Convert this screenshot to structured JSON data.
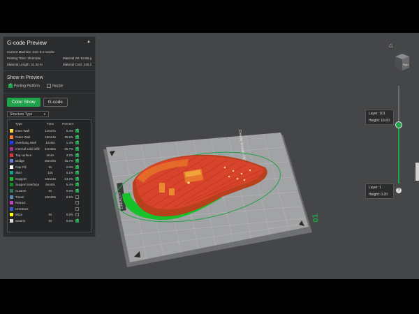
{
  "panel": {
    "title": "G-code Preview",
    "current_machine": "Current Machine: K1C 0.4 nozzle",
    "printing_time": "Printing Time: 2h4m16s",
    "material_wt": "Material Wt: 63.88 g",
    "material_length": "Material Length: 21.42 m",
    "material_cost": "Material Cost: 415.2",
    "show_in_preview": "Show in Preview",
    "printing_platform": "Printing Platform",
    "nozzle": "Nozzle",
    "tab_color_show": "Color Show",
    "tab_gcode": "G-code",
    "structure_select": "Structure Type",
    "legend_headers": {
      "type": "Type",
      "time": "Time",
      "percent": "Percent"
    },
    "legend": [
      {
        "color": "#ffd83a",
        "type": "Inner Wall",
        "time": "11m37s",
        "percent": "9.4%",
        "checked": true
      },
      {
        "color": "#ff7a2e",
        "type": "Outer Wall",
        "time": "19m24s",
        "percent": "15.6%",
        "checked": true
      },
      {
        "color": "#1e3cff",
        "type": "Overhang Wall",
        "time": "1m45s",
        "percent": "1.4%",
        "checked": true
      },
      {
        "color": "#b0309a",
        "type": "Internal solid infill",
        "time": "31m55s",
        "percent": "25.7%",
        "checked": true
      },
      {
        "color": "#e8333b",
        "type": "Top surface",
        "time": "4m2s",
        "percent": "3.2%",
        "checked": true
      },
      {
        "color": "#6b7dd6",
        "type": "Bridge",
        "time": "20m46s",
        "percent": "16.7%",
        "checked": true
      },
      {
        "color": "#ffffff",
        "type": "Gap Fill",
        "time": "0s",
        "percent": "0.0%",
        "checked": true
      },
      {
        "color": "#13a18f",
        "type": "Skirt",
        "time": "10s",
        "percent": "0.1%",
        "checked": true
      },
      {
        "color": "#16c22e",
        "type": "Support",
        "time": "16m21s",
        "percent": "13.2%",
        "checked": true
      },
      {
        "color": "#0f8e1e",
        "type": "Support interface",
        "time": "6m40s",
        "percent": "5.4%",
        "checked": true
      },
      {
        "color": "#2f7a55",
        "type": "Custom",
        "time": "0s",
        "percent": "0.0%",
        "checked": true
      },
      {
        "color": "#5a8ab8",
        "type": "Travel",
        "time": "10m39s",
        "percent": "8.6%",
        "checked": false
      },
      {
        "color": "#c040c0",
        "type": "Retract",
        "time": "",
        "percent": "",
        "checked": false
      },
      {
        "color": "#3a5ad0",
        "type": "Unretract",
        "time": "",
        "percent": "",
        "checked": false
      },
      {
        "color": "#ffff00",
        "type": "Wipe",
        "time": "0s",
        "percent": "0.0%",
        "checked": false
      },
      {
        "color": "#e0e0e0",
        "type": "Seams",
        "time": "0s",
        "percent": "0.0%",
        "checked": true
      }
    ]
  },
  "slider": {
    "top_layer": "Layer: 101",
    "top_height": "Height: 16.60",
    "bottom_layer": "Layer: 1",
    "bottom_height": "Height: 0.20"
  },
  "bed": {
    "plate_number": "01",
    "brand": "CREALITY",
    "plate_text": "Creality Smooth PEI Plate"
  },
  "cube_label": "Right",
  "colors": {
    "accent": "#1fa24a",
    "viewport": "#454648",
    "panel": "#2b2c2e"
  }
}
